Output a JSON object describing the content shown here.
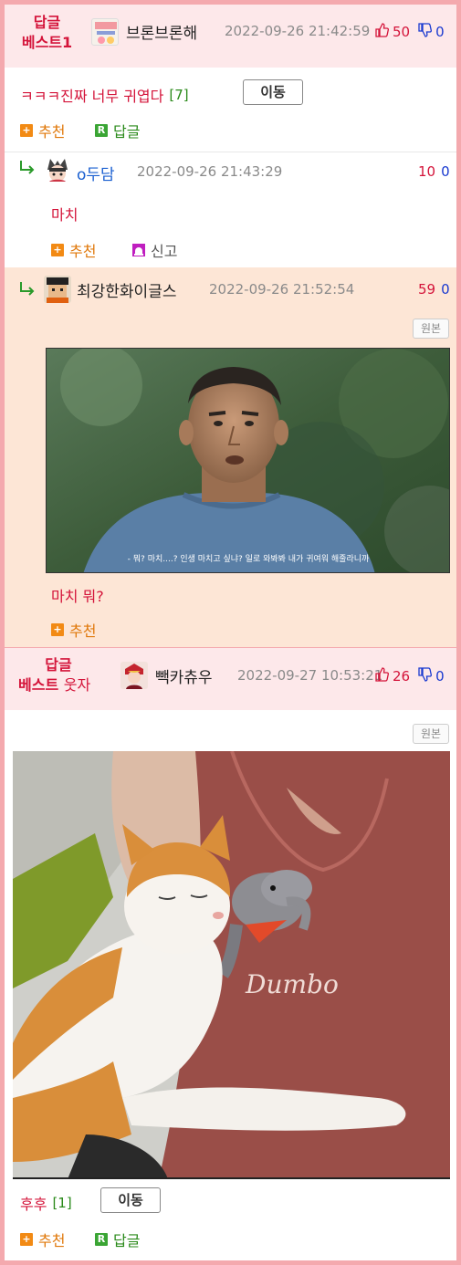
{
  "comments": [
    {
      "best_label_line1": "답글",
      "best_label_line2": "베스트1",
      "nickname": "브론브론해",
      "date": "2022-09-26 21:42:59",
      "up": "50",
      "down": "0",
      "text": "ㅋㅋㅋ진짜 너무 귀엽다",
      "reply_count": "[7]",
      "move_label": "이동",
      "recommend_label": "추천",
      "reply_label": "답글"
    },
    {
      "nickname": "o두담",
      "date": "2022-09-26 21:43:29",
      "up": "10",
      "down": "0",
      "text": "마치",
      "recommend_label": "추천",
      "report_label": "신고"
    },
    {
      "nickname": "최강한화이글스",
      "date": "2022-09-26 21:52:54",
      "up": "59",
      "down": "0",
      "original_label": "원본",
      "subtitle": "- 뭐? 마치....? 인생 마치고 싶냐? 일로 와봐봐 내가 귀여워 해줄라니까",
      "text": "마치 뭐?",
      "recommend_label": "추천"
    },
    {
      "best_label_line1": "답글",
      "best_label_line2": "베스트",
      "best_label_cat": "웃자",
      "nickname": "빽카츄우",
      "date": "2022-09-27 10:53:21",
      "up": "26",
      "down": "0",
      "original_label": "원본",
      "shirt_text": "Dumbo",
      "text": "후후",
      "reply_count": "[1]",
      "move_label": "이동",
      "recommend_label": "추천",
      "reply_label": "답글"
    }
  ],
  "icons": {
    "reply_arrow": "↳",
    "thumb_up": "👍",
    "thumb_down": "👎"
  },
  "colors": {
    "border": "#f4a9ae",
    "best_bg": "#fde8ea",
    "highlight_bg": "#fde6d6",
    "accent_red": "#d4143a",
    "down_blue": "#1a3ad0"
  }
}
